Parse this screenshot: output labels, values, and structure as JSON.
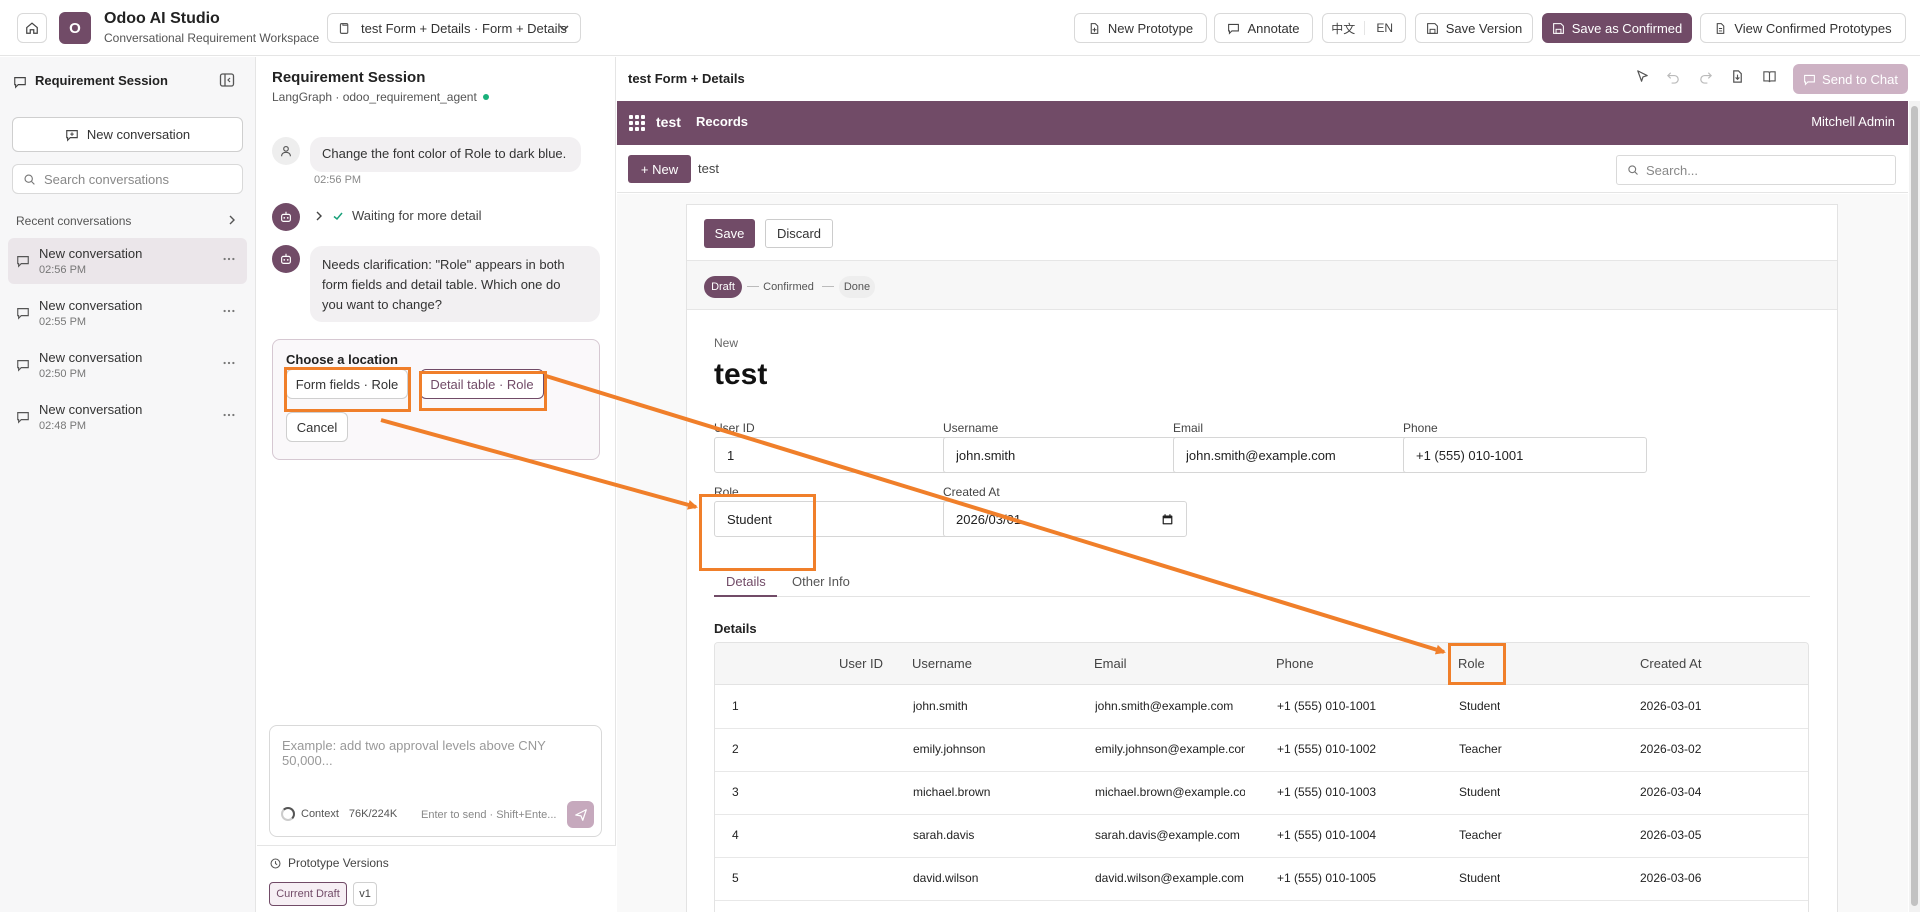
{
  "header": {
    "app_logo_letter": "O",
    "app_title": "Odoo AI Studio",
    "app_subtitle": "Conversational Requirement Workspace",
    "prototype_select": "test Form + Details · Form + Details",
    "new_prototype": "New Prototype",
    "annotate": "Annotate",
    "lang_zh": "中文",
    "lang_en": "EN",
    "save_version": "Save Version",
    "save_confirmed": "Save as Confirmed",
    "view_confirmed": "View Confirmed Prototypes"
  },
  "sidebar": {
    "title": "Requirement Session",
    "new_conversation": "New conversation",
    "search_placeholder": "Search conversations",
    "recent_label": "Recent conversations",
    "conversations": [
      {
        "title": "New conversation",
        "time": "02:56 PM"
      },
      {
        "title": "New conversation",
        "time": "02:55 PM"
      },
      {
        "title": "New conversation",
        "time": "02:50 PM"
      },
      {
        "title": "New conversation",
        "time": "02:48 PM"
      }
    ]
  },
  "chat": {
    "title": "Requirement Session",
    "subtitle": "LangGraph · odoo_requirement_agent",
    "user_message": "Change the font color of Role to dark blue.",
    "user_time": "02:56 PM",
    "waiting": "Waiting for more detail",
    "bot_lines": [
      "Needs clarification: \"Role\" appears in both",
      "form fields and detail table. Which one do",
      "you want to change?"
    ],
    "choose_title": "Choose a location",
    "option_form": "Form fields · Role",
    "option_detail": "Detail table · Role",
    "cancel": "Cancel",
    "composer_placeholder": "Example: add two approval levels above CNY 50,000...",
    "context_label": "Context",
    "context_value": "76K/224K",
    "enter_hint": "Enter to send · Shift+Ente...",
    "versions_title": "Prototype Versions",
    "version_current": "Current Draft",
    "version_v1": "v1"
  },
  "preview": {
    "title": "test Form + Details",
    "send_to_chat": "Send to Chat",
    "nav_app": "test",
    "nav_records": "Records",
    "nav_user": "Mitchell Admin",
    "new_button": "+ New",
    "breadcrumb": "test",
    "search_placeholder": "Search...",
    "save": "Save",
    "discard": "Discard",
    "stages": [
      "Draft",
      "Confirmed",
      "Done"
    ],
    "record_label": "New",
    "record_name": "test",
    "fields": {
      "user_id_label": "User ID",
      "user_id": "1",
      "username_label": "Username",
      "username": "john.smith",
      "email_label": "Email",
      "email": "john.smith@example.com",
      "phone_label": "Phone",
      "phone": "+1 (555) 010-1001",
      "role_label": "Role",
      "role": "Student",
      "created_label": "Created At",
      "created": "2026/03/01"
    },
    "tabs": [
      "Details",
      "Other Info"
    ],
    "section_title": "Details",
    "table": {
      "headers": [
        "User ID",
        "Username",
        "Email",
        "Phone",
        "Role",
        "Created At"
      ],
      "rows": [
        [
          "1",
          "john.smith",
          "john.smith@example.com",
          "+1 (555) 010-1001",
          "Student",
          "2026-03-01"
        ],
        [
          "2",
          "emily.johnson",
          "emily.johnson@example.com",
          "+1 (555) 010-1002",
          "Teacher",
          "2026-03-02"
        ],
        [
          "3",
          "michael.brown",
          "michael.brown@example.com",
          "+1 (555) 010-1003",
          "Student",
          "2026-03-04"
        ],
        [
          "4",
          "sarah.davis",
          "sarah.davis@example.com",
          "+1 (555) 010-1004",
          "Teacher",
          "2026-03-05"
        ],
        [
          "5",
          "david.wilson",
          "david.wilson@example.com",
          "+1 (555) 010-1005",
          "Student",
          "2026-03-06"
        ]
      ]
    }
  },
  "colors": {
    "brand": "#714b67",
    "annotation": "#f07f2a",
    "online": "#19b07a"
  }
}
